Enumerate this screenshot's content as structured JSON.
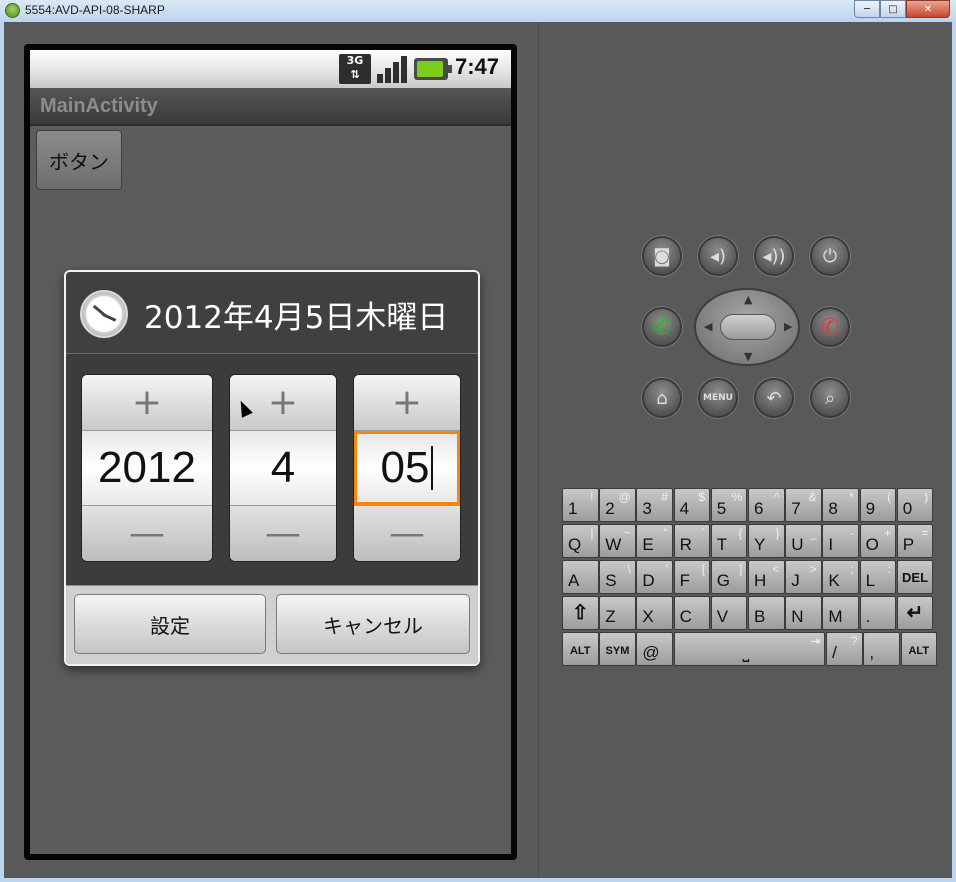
{
  "window": {
    "title": "5554:AVD-API-08-SHARP",
    "minimize": "─",
    "maximize": "□",
    "close": "✕"
  },
  "statusbar": {
    "network": "3G",
    "time": "7:47"
  },
  "app": {
    "title": "MainActivity",
    "button_label": "ボタン"
  },
  "dialog": {
    "title": "2012年4月5日木曜日",
    "icon": "clock-icon",
    "year": "2012",
    "month": "4",
    "day": "05",
    "plus": "+",
    "minus": "—",
    "set_label": "設定",
    "cancel_label": "キャンセル",
    "focus_color": "#f7860a"
  },
  "hardware": {
    "menu_label": "MENU",
    "buttons": [
      "camera-icon",
      "volume-down-icon",
      "volume-up-icon",
      "power-icon",
      "call-icon",
      "end-call-icon",
      "home-icon",
      "menu",
      "back-icon",
      "search-icon"
    ]
  },
  "keyboard": {
    "row1": [
      [
        "1",
        "!"
      ],
      [
        "2",
        "@"
      ],
      [
        "3",
        "#"
      ],
      [
        "4",
        "$"
      ],
      [
        "5",
        "%"
      ],
      [
        "6",
        "^"
      ],
      [
        "7",
        "&"
      ],
      [
        "8",
        "*"
      ],
      [
        "9",
        "("
      ],
      [
        "0",
        ")"
      ]
    ],
    "row2": [
      [
        "Q",
        "|"
      ],
      [
        "W",
        "~"
      ],
      [
        "E",
        "\""
      ],
      [
        "R",
        "`"
      ],
      [
        "T",
        "{"
      ],
      [
        "Y",
        "}"
      ],
      [
        "U",
        "_"
      ],
      [
        "I",
        "-"
      ],
      [
        "O",
        "+"
      ],
      [
        "P",
        "="
      ]
    ],
    "row3": [
      [
        "A",
        ""
      ],
      [
        "S",
        "\\"
      ],
      [
        "D",
        "'"
      ],
      [
        "F",
        "["
      ],
      [
        "G",
        "]"
      ],
      [
        "H",
        "<"
      ],
      [
        "J",
        ">"
      ],
      [
        "K",
        ";"
      ],
      [
        "L",
        ":"
      ],
      [
        "DEL",
        ""
      ]
    ],
    "row4": [
      [
        "⇧",
        ""
      ],
      [
        "Z",
        ""
      ],
      [
        "X",
        ""
      ],
      [
        "C",
        ""
      ],
      [
        "V",
        ""
      ],
      [
        "B",
        ""
      ],
      [
        "N",
        ""
      ],
      [
        "M",
        ""
      ],
      [
        ".",
        ""
      ],
      [
        "↵",
        ""
      ]
    ],
    "row5": [
      [
        "ALT",
        ""
      ],
      [
        "SYM",
        ""
      ],
      [
        "@",
        ""
      ],
      [
        "⎵",
        "⇥"
      ],
      [
        "/",
        "?"
      ],
      [
        ",",
        ""
      ],
      [
        "ALT",
        ""
      ]
    ]
  }
}
